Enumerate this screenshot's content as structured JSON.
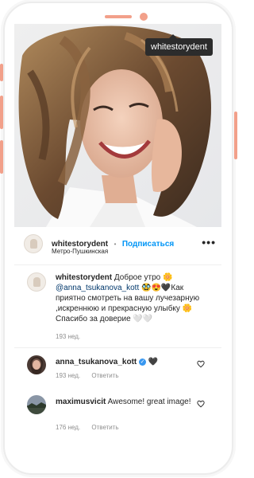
{
  "colors": {
    "accent": "#f2a08a",
    "link": "#0095f6",
    "tooltip_bg": "#2c2c2c"
  },
  "tooltip": "whitestorydent",
  "post": {
    "username": "whitestorydent",
    "dot": "•",
    "follow_label": "Подписаться",
    "location": "Метро-Пушкинская",
    "more_icon": "more-horizontal-icon",
    "more_label": "•••"
  },
  "caption": {
    "username": "whitestorydent",
    "text_1": "Доброе утро 🌼",
    "mention": "@anna_tsukanova_kott",
    "text_2": "🥸😍🖤Как приятно смотреть на вашу лучезарную ,искреннюю и прекрасную улыбку 🌼 Спасибо за доверие 🤍🤍",
    "time": "193 нед."
  },
  "comments": [
    {
      "username": "anna_tsukanova_kott",
      "verified": "✓",
      "text": "🖤",
      "time": "193 нед.",
      "reply": "Ответить"
    },
    {
      "username": "maximusvicit",
      "text": "Awesome! great image!",
      "time": "176 нед.",
      "reply": "Ответить"
    }
  ]
}
